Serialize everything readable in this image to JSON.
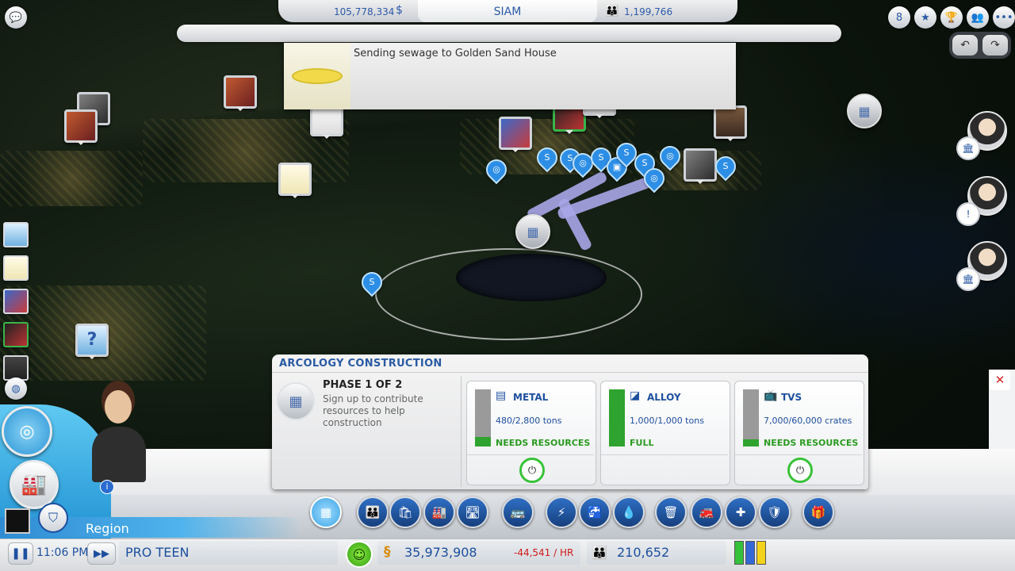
{
  "topbar": {
    "money": "105,778,334",
    "city_name": "SIAM",
    "population": "1,199,766",
    "money_icon": "simoleon-icon",
    "pop_icon": "population-icon"
  },
  "notification": {
    "text": "Sending sewage to Golden Sand House"
  },
  "controls": {
    "undo": "↶",
    "redo": "↷",
    "top_icons": [
      "achievement-icon",
      "awards-icon",
      "trophy-icon",
      "friends-icon",
      "more-icon"
    ]
  },
  "arcology": {
    "title": "ARCOLOGY CONSTRUCTION",
    "phase": "PHASE 1 OF 2",
    "desc": "Sign up to contribute resources to help construction",
    "resources": [
      {
        "name": "METAL",
        "amount": "480/2,800 tons",
        "status": "NEEDS RESOURCES",
        "fill": 0.17,
        "icon": "metal-icon"
      },
      {
        "name": "ALLOY",
        "amount": "1,000/1,000 tons",
        "status": "FULL",
        "fill": 1.0,
        "icon": "alloy-icon"
      },
      {
        "name": "TVS",
        "amount": "7,000/60,000 crates",
        "status": "NEEDS RESOURCES",
        "fill": 0.12,
        "icon": "tv-icon"
      }
    ],
    "close": "✕"
  },
  "hud": {
    "region_label": "Region",
    "time": "11:06 PM",
    "status": "PRO TEEN",
    "money": "35,973,908",
    "rate": "-44,541 / HR",
    "population": "210,652",
    "info": "i",
    "rci": [
      {
        "color": "#33c23a",
        "level": 1.0
      },
      {
        "color": "#3468d6",
        "level": 1.0
      },
      {
        "color": "#f2d21b",
        "level": 1.0
      }
    ]
  },
  "tools": [
    {
      "name": "arcology-tool",
      "glyph": "▦"
    },
    {
      "name": "residential-tool",
      "glyph": "👪"
    },
    {
      "name": "commercial-tool",
      "glyph": "🛍"
    },
    {
      "name": "industrial-tool",
      "glyph": "🏭"
    },
    {
      "name": "roads-tool",
      "glyph": "🛣"
    },
    {
      "name": "transport-tool",
      "glyph": "🚌"
    },
    {
      "name": "power-tool",
      "glyph": "⚡"
    },
    {
      "name": "water-tool",
      "glyph": "🚰"
    },
    {
      "name": "sewage-tool",
      "glyph": "💧"
    },
    {
      "name": "garbage-tool",
      "glyph": "🗑"
    },
    {
      "name": "fire-tool",
      "glyph": "🚒"
    },
    {
      "name": "health-tool",
      "glyph": "✚"
    },
    {
      "name": "police-tool",
      "glyph": "🛡"
    },
    {
      "name": "gift-tool",
      "glyph": "🎁"
    }
  ]
}
